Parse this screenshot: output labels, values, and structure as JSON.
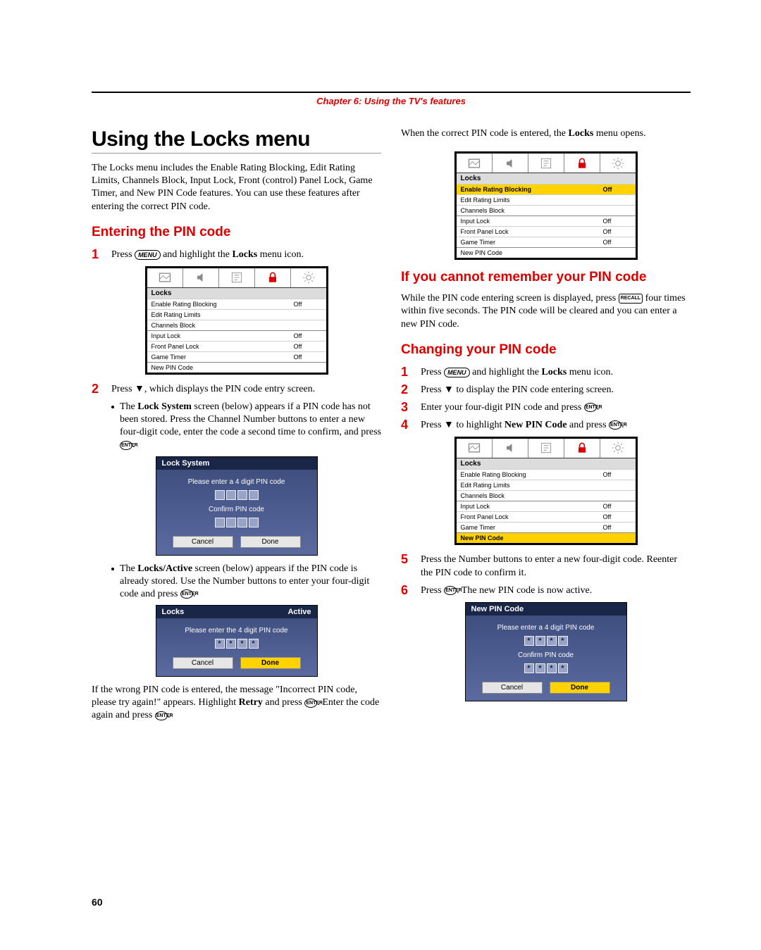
{
  "chapter": "Chapter 6: Using the TV's features",
  "page_number": "60",
  "left": {
    "title": "Using the Locks menu",
    "intro": "The Locks menu includes the Enable Rating Blocking, Edit Rating Limits, Channels Block, Input Lock, Front (control) Panel Lock, Game Timer, and New PIN Code features. You can use these features after entering the correct PIN code.",
    "sub1": "Entering the PIN code",
    "step1_a": "Press ",
    "step1_b": " and highlight the ",
    "step1_bold": "Locks",
    "step1_c": " menu icon.",
    "step2": "Press ▼, which displays the PIN code entry screen.",
    "bullet1_a": "The ",
    "bullet1_bold": "Lock System",
    "bullet1_b": " screen (below) appears if a PIN code has not been stored. Press the Channel Number buttons to enter a new four-digit code, enter the code a second time to confirm, and press ",
    "bullet1_c": ".",
    "bullet2_a": "The ",
    "bullet2_bold": "Locks/Active",
    "bullet2_b": " screen (below) appears if the PIN code is already stored. Use the Number buttons to enter your four-digit code and press ",
    "bullet2_c": ".",
    "wrong_a": "If the wrong PIN code is entered, the message \"Incorrect PIN code, please try again!\" appears. Highlight ",
    "wrong_bold": "Retry",
    "wrong_b": " and press ",
    "wrong_c": ". Enter the code again and press ",
    "wrong_d": ".",
    "osd1": {
      "title": "Locks",
      "rows": [
        {
          "label": "Enable Rating Blocking",
          "val": "Off",
          "hl": false
        },
        {
          "label": "Edit Rating Limits",
          "val": "",
          "hl": false
        },
        {
          "label": "Channels Block",
          "val": "",
          "hl": false
        },
        {
          "label": "Input Lock",
          "val": "Off",
          "hl": false,
          "sep": true
        },
        {
          "label": "Front Panel Lock",
          "val": "Off",
          "hl": false
        },
        {
          "label": "Game Timer",
          "val": "Off",
          "hl": false
        },
        {
          "label": "New PIN Code",
          "val": "",
          "hl": false,
          "sep": true
        }
      ]
    },
    "dlg_lock": {
      "title": "Lock System",
      "msg1": "Please enter a 4 digit PIN code",
      "msg2": "Confirm PIN code",
      "btn1": "Cancel",
      "btn2": "Done"
    },
    "dlg_active": {
      "title_l": "Locks",
      "title_r": "Active",
      "msg1": "Please enter the 4 digit PIN code",
      "btn1": "Cancel",
      "btn2": "Done"
    }
  },
  "right": {
    "intro_a": "When the correct PIN code is entered, the ",
    "intro_bold": "Locks",
    "intro_b": " menu opens.",
    "osd2": {
      "title": "Locks",
      "rows": [
        {
          "label": "Enable Rating Blocking",
          "val": "Off",
          "hl": true
        },
        {
          "label": "Edit Rating Limits",
          "val": "",
          "hl": false
        },
        {
          "label": "Channels Block",
          "val": "",
          "hl": false
        },
        {
          "label": "Input Lock",
          "val": "Off",
          "hl": false,
          "sep": true
        },
        {
          "label": "Front Panel Lock",
          "val": "Off",
          "hl": false
        },
        {
          "label": "Game Timer",
          "val": "Off",
          "hl": false
        },
        {
          "label": "New PIN Code",
          "val": "",
          "hl": false,
          "sep": true
        }
      ]
    },
    "sub_forgot": "If you cannot remember your PIN code",
    "forgot_a": "While the PIN code entering screen is displayed, press ",
    "forgot_b": " four times within five seconds. The PIN code will be cleared and you can enter a new PIN code.",
    "sub_change": "Changing your PIN code",
    "c1_a": "Press ",
    "c1_b": " and highlight the ",
    "c1_bold": "Locks",
    "c1_c": " menu icon.",
    "c2": "Press ▼ to display the PIN code entering screen.",
    "c3_a": "Enter your four-digit PIN code and press ",
    "c3_b": ".",
    "c4_a": "Press ▼ to highlight ",
    "c4_bold": "New PIN Code",
    "c4_b": " and press ",
    "c4_c": ".",
    "osd3": {
      "title": "Locks",
      "rows": [
        {
          "label": "Enable Rating Blocking",
          "val": "Off",
          "hl": false
        },
        {
          "label": "Edit Rating Limits",
          "val": "",
          "hl": false
        },
        {
          "label": "Channels Block",
          "val": "",
          "hl": false
        },
        {
          "label": "Input Lock",
          "val": "Off",
          "hl": false,
          "sep": true
        },
        {
          "label": "Front Panel Lock",
          "val": "Off",
          "hl": false
        },
        {
          "label": "Game Timer",
          "val": "Off",
          "hl": false
        },
        {
          "label": "New PIN Code",
          "val": "",
          "hl": true,
          "sep": true
        }
      ]
    },
    "c5": "Press the Number buttons to enter a new four-digit code. Reenter the PIN code to confirm it.",
    "c6_a": "Press ",
    "c6_b": ". The new PIN code is now active.",
    "dlg_new": {
      "title": "New PIN Code",
      "msg1": "Please enter a 4 digit PIN code",
      "msg2": "Confirm PIN code",
      "btn1": "Cancel",
      "btn2": "Done"
    }
  },
  "keys": {
    "menu": "MENU",
    "enter": "ENTER",
    "recall": "RECALL"
  }
}
